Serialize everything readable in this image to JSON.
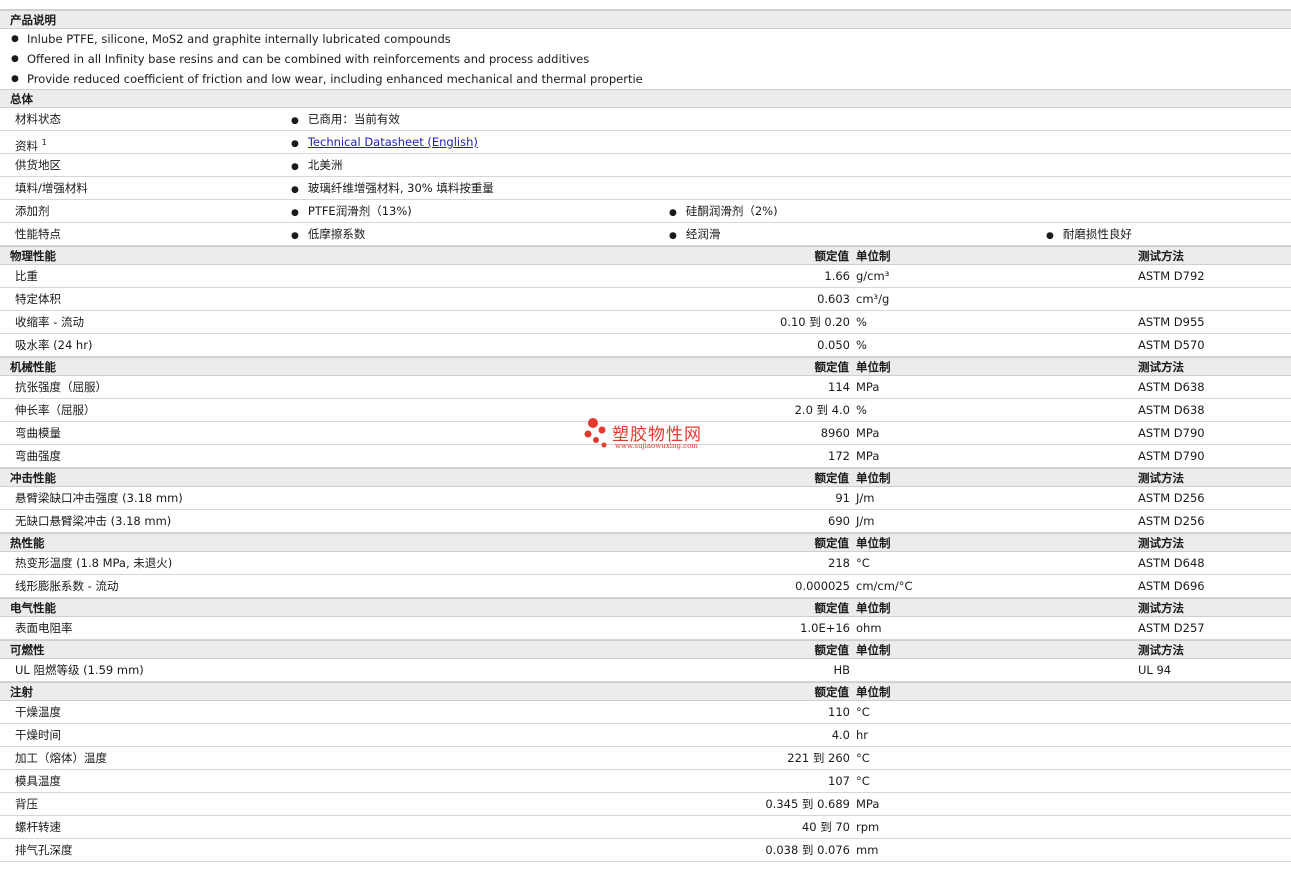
{
  "description": {
    "title": "产品说明",
    "items": [
      "Inlube PTFE, silicone, MoS2 and graphite internally lubricated compounds",
      "Offered in all Infinity base resins and can be combined with reinforcements and process additives",
      "Provide reduced coefficient of friction and low wear, including enhanced mechanical and thermal propertie"
    ]
  },
  "general": {
    "title": "总体",
    "rows": [
      {
        "label": "材料状态",
        "c2": "已商用：当前有效"
      },
      {
        "label": "资料",
        "sup": "1",
        "link": "Technical Datasheet (English)"
      },
      {
        "label": "供货地区",
        "c2": "北美洲"
      },
      {
        "label": "填料/增强材料",
        "c2": "玻璃纤维增强材料, 30% 填料按重量"
      },
      {
        "label": "添加剂",
        "c2": "PTFE润滑剂（13%)",
        "c3": "硅酮润滑剂（2%)"
      },
      {
        "label": "性能特点",
        "c2": "低摩擦系数",
        "c3": "经润滑",
        "c4": "耐磨损性良好"
      }
    ]
  },
  "headers": {
    "value": "额定值",
    "unit": "单位制",
    "method": "测试方法"
  },
  "sections": [
    {
      "title": "物理性能",
      "method_header": true,
      "rows": [
        {
          "label": "比重",
          "value": "1.66",
          "unit": "g/cm³",
          "method": "ASTM D792"
        },
        {
          "label": "特定体积",
          "value": "0.603",
          "unit": "cm³/g",
          "method": ""
        },
        {
          "label": "收缩率 - 流动",
          "value": "0.10 到  0.20",
          "unit": "%",
          "method": "ASTM D955"
        },
        {
          "label": "吸水率 (24 hr)",
          "value": "0.050",
          "unit": "%",
          "method": "ASTM D570"
        }
      ]
    },
    {
      "title": "机械性能",
      "method_header": true,
      "rows": [
        {
          "label": "抗张强度（屈服）",
          "value": "114",
          "unit": "MPa",
          "method": "ASTM D638"
        },
        {
          "label": "伸长率（屈服）",
          "value": "2.0 到  4.0",
          "unit": "%",
          "method": "ASTM D638"
        },
        {
          "label": "弯曲模量",
          "value": "8960",
          "unit": "MPa",
          "method": "ASTM D790"
        },
        {
          "label": "弯曲强度",
          "value": "172",
          "unit": "MPa",
          "method": "ASTM D790"
        }
      ]
    },
    {
      "title": "冲击性能",
      "method_header": true,
      "rows": [
        {
          "label": "悬臂梁缺口冲击强度 (3.18 mm)",
          "value": "91",
          "unit": "J/m",
          "method": "ASTM D256"
        },
        {
          "label": "无缺口悬臂梁冲击 (3.18 mm)",
          "value": "690",
          "unit": "J/m",
          "method": "ASTM D256"
        }
      ]
    },
    {
      "title": "热性能",
      "method_header": true,
      "rows": [
        {
          "label": "热变形温度 (1.8 MPa, 未退火)",
          "value": "218",
          "unit": "°C",
          "method": "ASTM D648"
        },
        {
          "label": "线形膨胀系数 - 流动",
          "value": "0.000025",
          "unit": "cm/cm/°C",
          "method": "ASTM D696"
        }
      ]
    },
    {
      "title": "电气性能",
      "method_header": true,
      "rows": [
        {
          "label": "表面电阻率",
          "value": "1.0E+16",
          "unit": "ohm",
          "method": "ASTM D257"
        }
      ]
    },
    {
      "title": "可燃性",
      "method_header": true,
      "rows": [
        {
          "label": "UL 阻燃等级 (1.59 mm)",
          "value": "HB",
          "unit": "",
          "method": "UL 94"
        }
      ]
    },
    {
      "title": "注射",
      "method_header": false,
      "rows": [
        {
          "label": "干燥温度",
          "value": "110",
          "unit": "°C",
          "method": ""
        },
        {
          "label": "干燥时间",
          "value": "4.0",
          "unit": "hr",
          "method": ""
        },
        {
          "label": "加工（熔体）温度",
          "value": "221 到  260",
          "unit": "°C",
          "method": ""
        },
        {
          "label": "模具温度",
          "value": "107",
          "unit": "°C",
          "method": ""
        },
        {
          "label": "背压",
          "value": "0.345 到  0.689",
          "unit": "MPa",
          "method": ""
        },
        {
          "label": "螺杆转速",
          "value": "40 到  70",
          "unit": "rpm",
          "method": ""
        },
        {
          "label": "排气孔深度",
          "value": "0.038 到  0.076",
          "unit": "mm",
          "method": ""
        }
      ]
    }
  ],
  "watermark": {
    "text": "塑胶物性网",
    "url": "www.sujiaowuxing.com",
    "color": "#e23a2f"
  }
}
